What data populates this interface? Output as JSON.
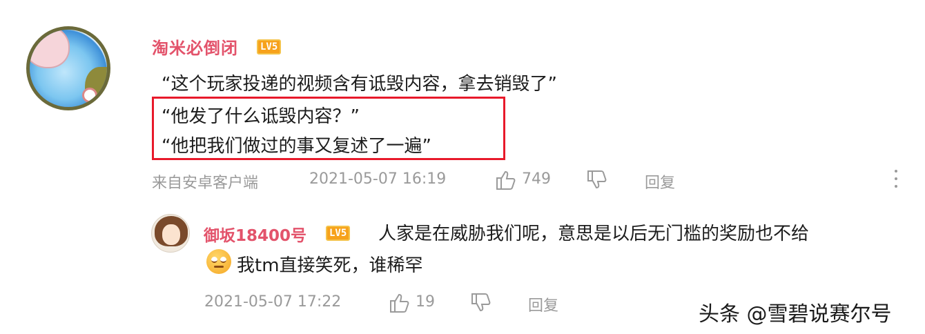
{
  "main_comment": {
    "username": "淘米必倒闭",
    "level_badge": "LV5",
    "lines": [
      "“这个玩家投递的视频含有诋毁内容，拿去销毁了”",
      "“他发了什么诋毁内容？”",
      "“他把我们做过的事又复述了一遍”"
    ],
    "source": "来自安卓客户端",
    "timestamp": "2021-05-07 16:19",
    "like_count": "749",
    "reply_label": "回复",
    "icons": {
      "like": "thumbs-up-icon",
      "dislike": "thumbs-down-icon",
      "more": "more-vertical-icon"
    }
  },
  "reply": {
    "username": "御坂18400号",
    "level_badge": "LV5",
    "text_line1": "人家是在威胁我们呢，意思是以后无门槛的奖励也不给",
    "text_line2": "我tm直接笑死，谁稀罕",
    "timestamp": "2021-05-07 17:22",
    "like_count": "19",
    "reply_label": "回复",
    "icons": {
      "emoji": "eye-roll-emoji-icon",
      "like": "thumbs-up-icon",
      "dislike": "thumbs-down-icon"
    }
  },
  "watermark": "头条 @雪碧说赛尔号",
  "colors": {
    "username": "#e3536b",
    "highlight_border": "#e8192a",
    "meta_text": "#9a9a9a",
    "badge": "#f7a21b"
  }
}
